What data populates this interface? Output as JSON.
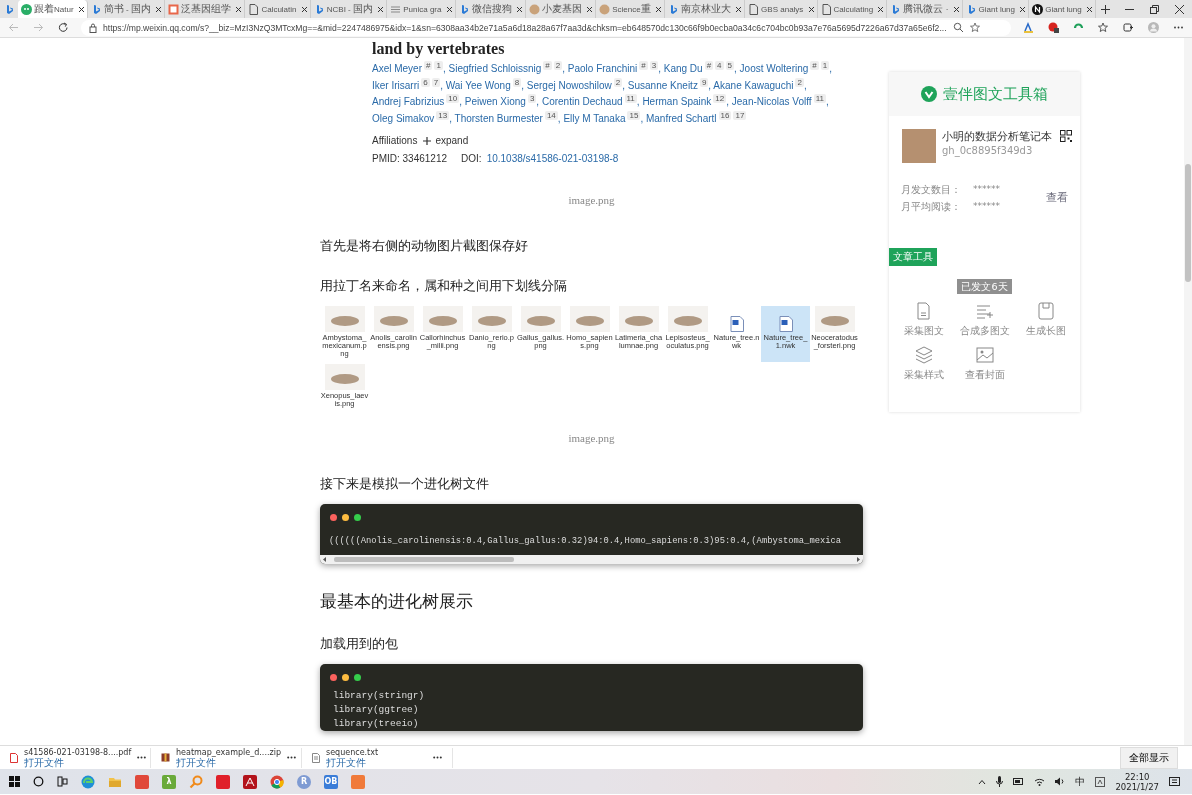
{
  "browser": {
    "tabs": [
      {
        "kind": "wechat",
        "title": "跟着Natur",
        "selected": true
      },
      {
        "kind": "bing",
        "title": "简书 - 国内",
        "selected": false
      },
      {
        "kind": "square",
        "title": "泛基因组学",
        "selected": false
      },
      {
        "kind": "doc",
        "title": "Calculatin",
        "selected": false
      },
      {
        "kind": "bing",
        "title": "NCBI - 国内",
        "selected": false
      },
      {
        "kind": "stripes",
        "title": "Punica gra",
        "selected": false
      },
      {
        "kind": "bing",
        "title": "微信搜狗",
        "selected": false
      },
      {
        "kind": "circle",
        "title": "小麦基因",
        "selected": false
      },
      {
        "kind": "circle",
        "title": "Science重",
        "selected": false
      },
      {
        "kind": "bing",
        "title": "南京林业大",
        "selected": false
      },
      {
        "kind": "doc",
        "title": "GBS analys",
        "selected": false
      },
      {
        "kind": "doc",
        "title": "Calculating",
        "selected": false
      },
      {
        "kind": "bing",
        "title": "腾讯微云 ·",
        "selected": false
      },
      {
        "kind": "bing",
        "title": "Giant lung",
        "selected": false
      },
      {
        "kind": "notion",
        "title": "Giant lung",
        "selected": false
      }
    ],
    "address": "https://mp.weixin.qq.com/s?__biz=MzI3NzQ3MTcxMg==&mid=2247486975&idx=1&sn=6308aa34b2e71a5a6d18a28a67f7aa3d&chksm=eb648570dc130c66f9b0ecba0a34c6c704bc0b93a7e76a5695d7226a67d37a65e6f2..."
  },
  "article": {
    "heading": "land by vertebrates",
    "authors": [
      {
        "name": "Axel Meyer",
        "marks": [
          "#",
          "1"
        ],
        "sep": ","
      },
      {
        "name": "Siegfried Schloissnig",
        "marks": [
          "#",
          "2"
        ],
        "sep": ","
      },
      {
        "name": "Paolo Franchini",
        "marks": [
          "#",
          "3"
        ],
        "sep": ","
      },
      {
        "name": "Kang Du",
        "marks": [
          "#",
          "4",
          "5"
        ],
        "sep": ","
      },
      {
        "name": "Joost Woltering",
        "marks": [
          "#",
          "1"
        ],
        "sep": ","
      },
      {
        "name": "Iker Irisarri",
        "marks": [
          "6",
          "7"
        ],
        "sep": ","
      },
      {
        "name": "Wai Yee Wong",
        "marks": [
          "8"
        ],
        "sep": ","
      },
      {
        "name": "Sergej Nowoshilow",
        "marks": [
          "2"
        ],
        "sep": ","
      },
      {
        "name": "Susanne Kneitz",
        "marks": [
          "9"
        ],
        "sep": ","
      },
      {
        "name": "Akane Kawaguchi",
        "marks": [
          "2"
        ],
        "sep": ","
      },
      {
        "name": "Andrej Fabrizius",
        "marks": [
          "10"
        ],
        "sep": ","
      },
      {
        "name": "Peiwen Xiong",
        "marks": [
          "3"
        ],
        "sep": ","
      },
      {
        "name": "Corentin Dechaud",
        "marks": [
          "11"
        ],
        "sep": ","
      },
      {
        "name": "Herman Spaink",
        "marks": [
          "12"
        ],
        "sep": ","
      },
      {
        "name": "Jean-Nicolas Volff",
        "marks": [
          "11"
        ],
        "sep": ","
      },
      {
        "name": "Oleg Simakov",
        "marks": [
          "13"
        ],
        "sep": ","
      },
      {
        "name": "Thorsten Burmester",
        "marks": [
          "14"
        ],
        "sep": ","
      },
      {
        "name": "Elly M Tanaka",
        "marks": [
          "15"
        ],
        "sep": ","
      },
      {
        "name": "Manfred Schartl",
        "marks": [
          "16",
          "17"
        ]
      }
    ],
    "affiliations": "Affiliations",
    "expand": "expand",
    "pmid": "PMID: 33461212",
    "doi_label": "DOI:",
    "doi": "10.1038/s41586-021-03198-8",
    "blocks": [
      {
        "kind": "caption",
        "text": "image.png"
      },
      {
        "kind": "para",
        "text": "首先是将右侧的动物图片截图保存好"
      },
      {
        "kind": "para",
        "text": "用拉丁名来命名，属和种之间用下划线分隔"
      },
      {
        "kind": "files",
        "files": [
          {
            "kind": "image",
            "name": "Ambystoma_mexicanum.png",
            "selected": false
          },
          {
            "kind": "image",
            "name": "Anolis_carolinensis.png",
            "selected": false
          },
          {
            "kind": "image",
            "name": "Callorhinchus_milii.png",
            "selected": false
          },
          {
            "kind": "image",
            "name": "Danio_rerio.png",
            "selected": false
          },
          {
            "kind": "image",
            "name": "Gallus_gallus.png",
            "selected": false
          },
          {
            "kind": "image",
            "name": "Homo_sapiens.png",
            "selected": false
          },
          {
            "kind": "image",
            "name": "Latimeria_chalumnae.png",
            "selected": false
          },
          {
            "kind": "image",
            "name": "Lepisosteus_oculatus.png",
            "selected": false
          },
          {
            "kind": "document",
            "name": "Nature_tree.nwk",
            "selected": false
          },
          {
            "kind": "document",
            "name": "Nature_tree_1.nwk",
            "selected": true
          },
          {
            "kind": "image",
            "name": "Neoceratodus_forsteri.png",
            "selected": false
          },
          {
            "kind": "image",
            "name": "Xenopus_laevis.png",
            "selected": false
          }
        ]
      },
      {
        "kind": "caption",
        "text": "image.png"
      },
      {
        "kind": "para",
        "text": "接下来是模拟一个进化树文件"
      },
      {
        "kind": "code",
        "scrollbar": true,
        "lines": [
          "((((((Anolis_carolinensis:0.4,Gallus_gallus:0.32)94:0.4,Homo_sapiens:0.3)95:0.4,(Ambystoma_mexica"
        ]
      },
      {
        "kind": "heading",
        "text": "最基本的进化树展示"
      },
      {
        "kind": "para",
        "text": "加载用到的包"
      },
      {
        "kind": "code",
        "scrollbar": false,
        "lines": [
          "library(stringr)",
          "library(ggtree)",
          "library(treeio)"
        ]
      }
    ]
  },
  "panel": {
    "title": "壹伴图文工具箱",
    "account": {
      "name": "小明的数据分析笔记本",
      "id": "gh_0c8895f349d3"
    },
    "stats": [
      {
        "label": "月发文数目：",
        "value": "******"
      },
      {
        "label": "月平均阅读：",
        "value": "******"
      }
    ],
    "view": "查看",
    "section": "文章工具",
    "age": "已发文6天",
    "tools": [
      {
        "label": "采集图文"
      },
      {
        "label": "合成多图文"
      },
      {
        "label": "生成长图"
      },
      {
        "label": "采集样式"
      },
      {
        "label": "查看封面"
      }
    ]
  },
  "downloads": {
    "items": [
      {
        "kind": "pdf",
        "name": "s41586-021-03198-8....pdf",
        "action": "打开文件"
      },
      {
        "kind": "zip",
        "name": "heatmap_example_d....zip",
        "action": "打开文件"
      },
      {
        "kind": "txt",
        "name": "sequence.txt",
        "action": "打开文件"
      }
    ],
    "show_all": "全部显示"
  },
  "taskbar": {
    "apps": [
      {
        "kind": "edge"
      },
      {
        "kind": "folder"
      },
      {
        "kind": "tile",
        "color": "#e0483a"
      },
      {
        "kind": "tile",
        "color": "#6aaa3a",
        "glyph": "λ"
      },
      {
        "kind": "key"
      },
      {
        "kind": "tile",
        "color": "#e0202a"
      },
      {
        "kind": "acrobat"
      },
      {
        "kind": "chrome"
      },
      {
        "kind": "round",
        "color": "#7f9bd3",
        "glyph": "R"
      },
      {
        "kind": "tile",
        "color": "#3b7dd8",
        "glyph": "OB"
      },
      {
        "kind": "tile",
        "color": "#f07a3a"
      }
    ],
    "ime": "中",
    "time": "22:10",
    "date": "2021/1/27"
  }
}
